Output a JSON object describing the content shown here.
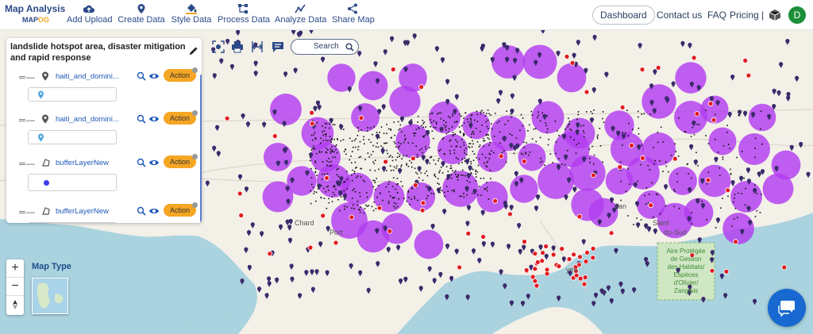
{
  "app": {
    "title": "Map Analysis",
    "logo_sub_a": "MAP",
    "logo_sub_b": "OG"
  },
  "toolbar": {
    "items": [
      {
        "label": "Add Upload",
        "icon": "cloud-upload-icon"
      },
      {
        "label": "Create Data",
        "icon": "map-pin-icon"
      },
      {
        "label": "Style Data",
        "icon": "paint-bucket-icon"
      },
      {
        "label": "Process Data",
        "icon": "process-nodes-icon"
      },
      {
        "label": "Analyze Data",
        "icon": "analyze-chart-icon"
      },
      {
        "label": "Share Map",
        "icon": "share-icon"
      }
    ]
  },
  "nav": {
    "dashboard": "Dashboard",
    "contact": "Contact us",
    "faq": "FAQ",
    "pricing": "Pricing |",
    "avatar_initial": "D"
  },
  "panel": {
    "title": "landslide hotspot area, disaster mitigation and rapid response",
    "layers": [
      {
        "name": "haiti_and_domini...",
        "type": "point",
        "action": "Action",
        "legend": "pin"
      },
      {
        "name": "haiti_and_domini...",
        "type": "point",
        "action": "Action",
        "legend": "pin"
      },
      {
        "name": "bufferLayerNew",
        "type": "polygon",
        "action": "Action",
        "legend": "dot"
      },
      {
        "name": "bufferLayerNew",
        "type": "polygon",
        "action": "Action",
        "legend": "dot"
      }
    ]
  },
  "maptools": {
    "search_label": "Search"
  },
  "map_labels": {
    "chard": "Chard",
    "port": "Port",
    "yes": "yes",
    "llan": "llan",
    "saint": "Saint",
    "du_sud": "du-Sud",
    "aire": "Aire Protégée\nde Gestion\ndes Habitats/\nEspèces\nd'Olivier/\nZanglais"
  },
  "maptype": {
    "label": "Map Type"
  },
  "colors": {
    "brand": "#2b4a87",
    "accent": "#f5a623",
    "buffer": "#b23cf0",
    "land": "#f3f0e8",
    "water": "#aad3df"
  }
}
